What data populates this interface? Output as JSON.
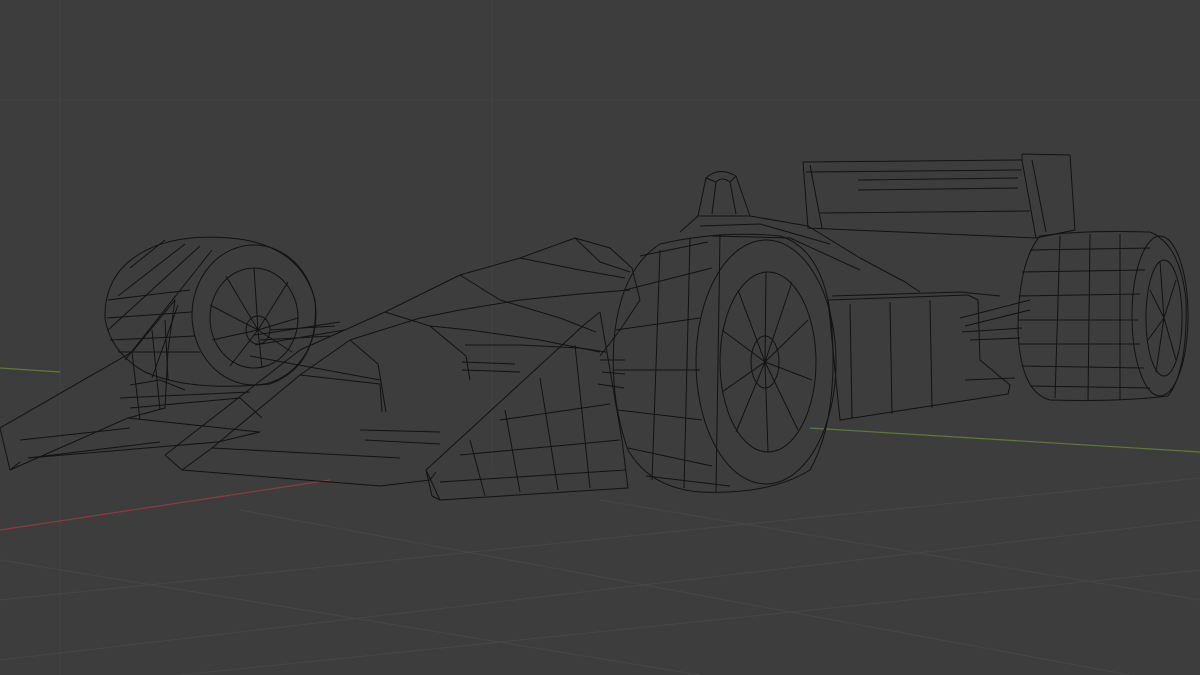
{
  "viewport": {
    "mode": "wireframe",
    "object": "formula-1-car",
    "colors": {
      "background": "#3d3d3d",
      "grid": "#474747",
      "wire": "#121212",
      "x_axis": "#8c3b42",
      "y_axis": "#5f7a3a"
    },
    "grid_visible": true,
    "axes_visible": true
  }
}
